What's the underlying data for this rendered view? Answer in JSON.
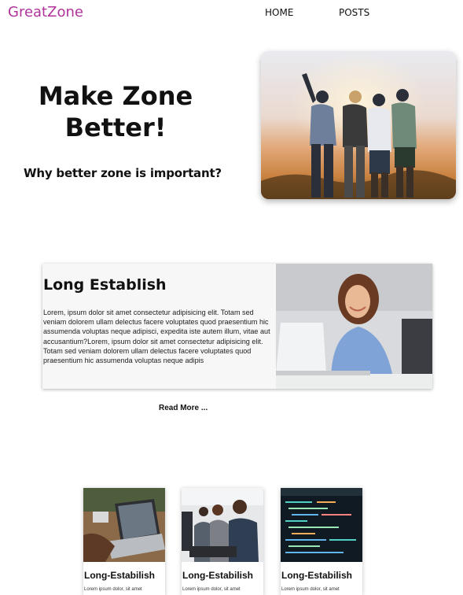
{
  "header": {
    "logo": "GreatZone",
    "nav": [
      "HOME",
      "POSTS"
    ]
  },
  "hero": {
    "title": "Make Zone Better!",
    "subtitle": "Why better zone is important?"
  },
  "feature": {
    "title": "Long Establish",
    "body": "Lorem, ipsum dolor sit amet consectetur adipisicing elit. Totam sed veniam dolorem ullam delectus facere voluptates quod praesentium hic assumenda voluptas neque adipisci, expedita iste autem illum, vitae aut accusantium?Lorem, ipsum dolor sit amet consectetur adipisicing elit. Totam sed veniam dolorem ullam delectus facere voluptates quod praesentium hic assumenda voluptas neque adipis",
    "read_more": "Read More ..."
  },
  "cards": [
    {
      "title": "Long-Estabilish",
      "text": "Lorem ipsum dolor, sit amet"
    },
    {
      "title": "Long-Estabilish",
      "text": "Lorem ipsum dolor, sit amet"
    },
    {
      "title": "Long-Estabilish",
      "text": "Lorem ipsum dolor, sit amet"
    }
  ],
  "colors": {
    "logo": "#b0339a",
    "feature_background": "#f7f7f7"
  }
}
